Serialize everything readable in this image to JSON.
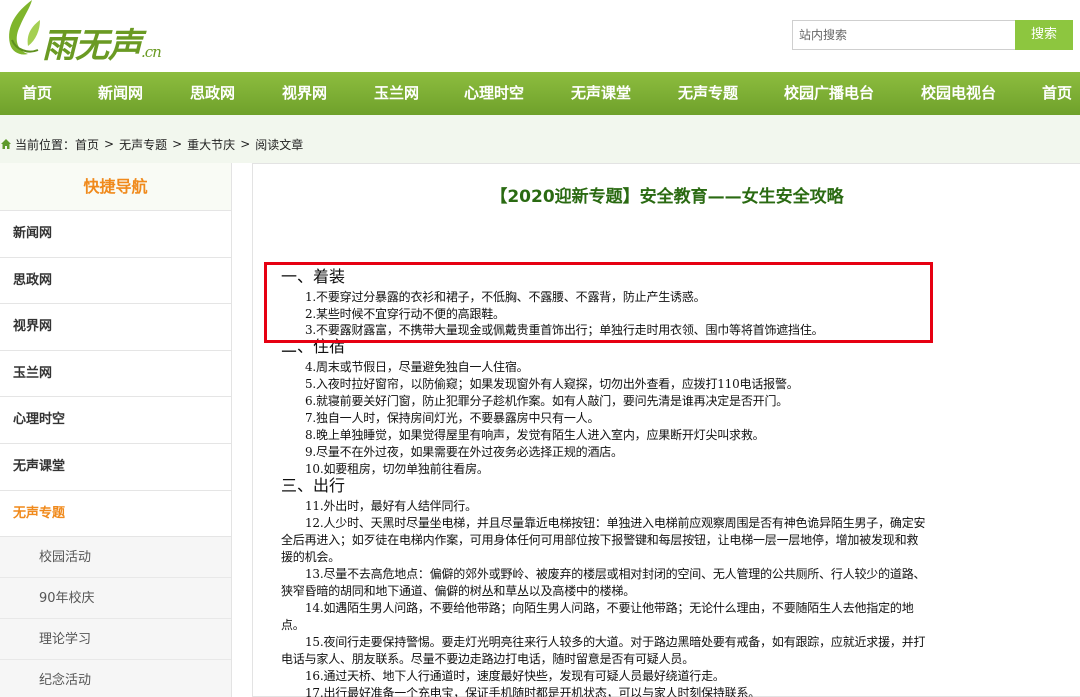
{
  "header": {
    "logo_text": "雨无声",
    "logo_suffix": ".cn",
    "search_placeholder": "站内搜索",
    "search_button": "搜索"
  },
  "nav": {
    "items": [
      "首页",
      "新闻网",
      "思政网",
      "视界网",
      "玉兰网",
      "心理时空",
      "无声课堂",
      "无声专题",
      "校园广播电台",
      "校园电视台",
      "首页"
    ]
  },
  "breadcrumb": {
    "prefix": "当前位置：",
    "items": [
      "首页",
      "无声专题",
      "重大节庆",
      "阅读文章"
    ],
    "separator": ">"
  },
  "sidebar": {
    "title": "快捷导航",
    "items": [
      "新闻网",
      "思政网",
      "视界网",
      "玉兰网",
      "心理时空",
      "无声课堂",
      "无声专题"
    ],
    "active": "无声专题",
    "subitems": [
      "校园活动",
      "90年校庆",
      "理论学习",
      "纪念活动"
    ]
  },
  "article": {
    "title": "【2020迎新专题】安全教育——女生安全攻略",
    "sections": [
      {
        "heading": "一、着装",
        "lines": [
          "1.不要穿过分暴露的衣衫和裙子，不低胸、不露腰、不露背，防止产生诱惑。",
          "2.某些时候不宜穿行动不便的高跟鞋。",
          "3.不要露财露富，不携带大量现金或佩戴贵重首饰出行；单独行走时用衣领、围巾等将首饰遮挡住。"
        ]
      },
      {
        "heading": "二、住宿",
        "lines": [
          "4.周末或节假日，尽量避免独自一人住宿。",
          "5.入夜时拉好窗帘，以防偷窥；如果发现窗外有人窥探，切勿出外查看，应拨打110电话报警。",
          "6.就寝前要关好门窗，防止犯罪分子趁机作案。如有人敲门，要问先清是谁再决定是否开门。",
          "7.独自一人时，保持房间灯光，不要暴露房中只有一人。",
          "8.晚上单独睡觉，如果觉得屋里有响声，发觉有陌生人进入室内，应果断开灯尖叫求救。",
          "9.尽量不在外过夜，如果需要在外过夜务必选择正规的酒店。",
          "10.如要租房，切勿单独前往看房。"
        ]
      },
      {
        "heading": "三、出行",
        "lines": [
          "11.外出时，最好有人结伴同行。",
          "12.人少时、天黑时尽量坐电梯，并且尽量靠近电梯按钮：单独进入电梯前应观察周围是否有神色诡异陌生男子，确定安",
          "全后再进入；如歹徒在电梯内作案，可用身体任何可用部位按下报警键和每层按钮，让电梯一层一层地停，增加被发现和救",
          "援的机会。",
          "13.尽量不去高危地点：偏僻的郊外或野岭、被废弃的楼层或相对封闭的空间、无人管理的公共厕所、行人较少的道路、",
          "狭窄昏暗的胡同和地下通道、偏僻的树丛和草丛以及高楼中的楼梯。",
          "14.如遇陌生男人问路，不要给他带路；向陌生男人问路，不要让他带路；无论什么理由，不要随陌生人去他指定的地",
          "点。",
          "15.夜间行走要保持警惕。要走灯光明亮往来行人较多的大道。对于路边黑暗处要有戒备，如有跟踪，应就近求援，并打",
          "电话与家人、朋友联系。尽量不要边走路边打电话，随时留意是否有可疑人员。",
          "16.通过天桥、地下人行通道时，速度最好快些，发现有可疑人员最好绕道行走。",
          "17.出行最好准备一个充电宝，保证手机随时都是开机状态，可以与家人时刻保持联系。"
        ]
      }
    ]
  },
  "colors": {
    "nav_green": "#7aae34",
    "accent_orange": "#f08a1c",
    "title_green": "#2a6a12",
    "highlight_red": "#e60012"
  }
}
